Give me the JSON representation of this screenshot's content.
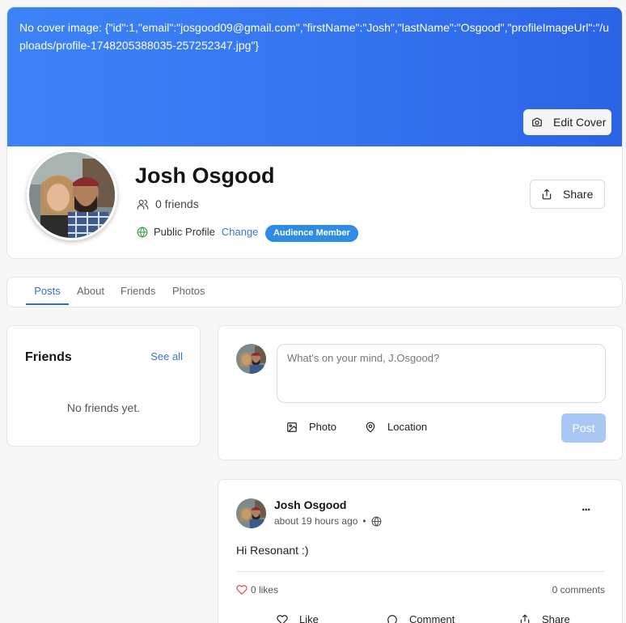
{
  "cover": {
    "text": "No cover image: {\"id\":1,\"email\":\"josgood09@gmail.com\",\"firstName\":\"Josh\",\"lastName\":\"Osgood\",\"profileImageUrl\":\"/uploads/profile-1748205388035-257252347.jpg\"}",
    "edit_label": "Edit Cover",
    "edit_icon": "camera-icon",
    "color": "#3574ef"
  },
  "profile": {
    "name": "Josh Osgood",
    "friends_count": "0 friends",
    "visibility": "Public Profile",
    "change_label": "Change",
    "badge": "Audience Member",
    "share_label": "Share"
  },
  "tabs": [
    {
      "label": "Posts",
      "active": true
    },
    {
      "label": "About",
      "active": false
    },
    {
      "label": "Friends",
      "active": false
    },
    {
      "label": "Photos",
      "active": false
    }
  ],
  "friends_panel": {
    "title": "Friends",
    "see_all": "See all",
    "empty": "No friends yet."
  },
  "composer": {
    "placeholder": "What's on your mind, J.Osgood?",
    "photo_label": "Photo",
    "location_label": "Location",
    "post_label": "Post"
  },
  "post": {
    "author": "Josh Osgood",
    "time": "about 19 hours ago",
    "separator": "•",
    "more": "...",
    "text": "Hi Resonant :)",
    "likes": "0 likes",
    "comments": "0 comments",
    "like_label": "Like",
    "comment_label": "Comment",
    "share_label": "Share"
  },
  "colors": {
    "accent": "#2f6ed8",
    "badge": "#2e8ce5",
    "post_button_disabled": "#a9c7f5",
    "globe": "#3aa35a"
  }
}
